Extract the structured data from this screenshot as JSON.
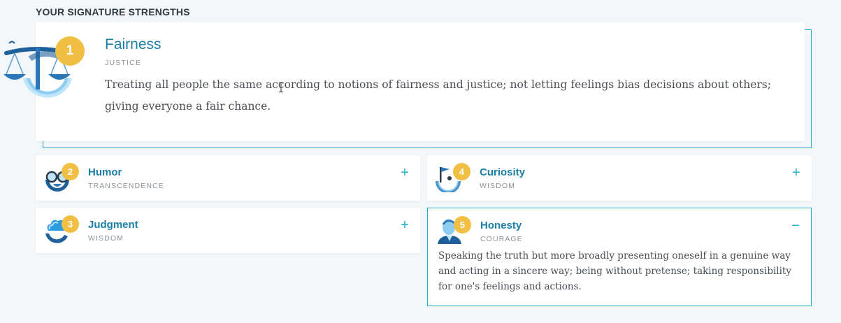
{
  "section_title": "YOUR SIGNATURE STRENGTHS",
  "top_strength": {
    "rank": "1",
    "name": "Fairness",
    "virtue": "JUSTICE",
    "description": "Treating all people the same according to notions of fairness and justice; not letting feelings bias decisions about others; giving everyone a fair chance.",
    "icon": "scales-icon"
  },
  "strengths": [
    {
      "rank": "2",
      "name": "Humor",
      "virtue": "TRANSCENDENCE",
      "toggle": "+",
      "icon": "humor-glasses-icon"
    },
    {
      "rank": "4",
      "name": "Curiosity",
      "virtue": "WISDOM",
      "toggle": "+",
      "icon": "curiosity-flag-icon"
    },
    {
      "rank": "3",
      "name": "Judgment",
      "virtue": "WISDOM",
      "toggle": "+",
      "icon": "judgment-cloud-icon"
    },
    {
      "rank": "5",
      "name": "Honesty",
      "virtue": "COURAGE",
      "toggle": "−",
      "icon": "honesty-person-icon",
      "description": "Speaking the truth but more broadly presenting oneself in a genuine way and acting in a sincere way; being without pretense; taking responsibility for one's feelings and actions."
    }
  ],
  "colors": {
    "accent": "#1cafc5",
    "name": "#1b7ea4",
    "badge": "#f1bf44",
    "background": "#f4f7fa"
  }
}
